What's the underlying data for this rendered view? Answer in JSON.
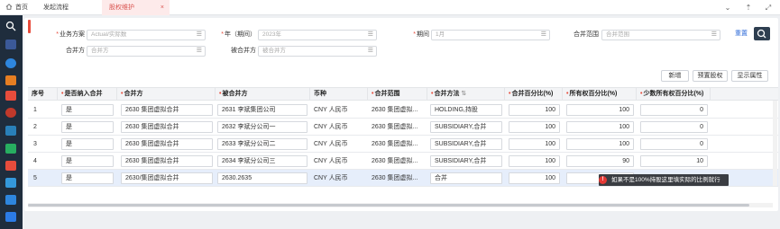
{
  "tabs": {
    "home": "首页",
    "flow": "发起流程",
    "active": "股权维护",
    "close": "×"
  },
  "window_controls": [
    "⌄",
    "⇡",
    "⤢"
  ],
  "filters": {
    "business_plan": {
      "label": "业务方案",
      "placeholder": "Actual/实际数"
    },
    "year": {
      "label": "年（期间）",
      "placeholder": "2023年"
    },
    "period": {
      "label": "期间",
      "placeholder": "1月"
    },
    "consol_scope": {
      "label": "合并范围",
      "placeholder": "合并范围"
    },
    "consol_party": {
      "label": "合并方",
      "placeholder": "合并方"
    },
    "consolidated_party": {
      "label": "被合并方",
      "placeholder": "被合并方"
    },
    "reset": "重置",
    "required_mark": "*"
  },
  "actions": {
    "add": "新增",
    "preset_equity": "预置股权",
    "display_props": "显示属性"
  },
  "table": {
    "columns": {
      "seq": "序号",
      "include": "是否纳入合并",
      "consol_party": "合并方",
      "consolidated_party": "被合并方",
      "currency": "币种",
      "scope": "合并范围",
      "method": "合并方法",
      "consol_pct": "合并百分比(%)",
      "ownership_pct": "所有权百分比(%)",
      "minority_pct": "少数所有权百分比(%)"
    },
    "sort_mark": "⇅",
    "rows": [
      {
        "seq": "1",
        "include": "是",
        "consol_party": "2630 集团虚拟合并",
        "consolidated_party": "2631 李斌集团公司",
        "currency": "CNY 人民币",
        "scope": "2630 集团虚拟...",
        "method": "HOLDING,持股",
        "consol_pct": "100",
        "ownership_pct": "100",
        "minority_pct": "0"
      },
      {
        "seq": "2",
        "include": "是",
        "consol_party": "2630 集团虚拟合并",
        "consolidated_party": "2632 李斌分公司一",
        "currency": "CNY 人民币",
        "scope": "2630 集团虚拟...",
        "method": "SUBSIDIARY,合并",
        "consol_pct": "100",
        "ownership_pct": "100",
        "minority_pct": "0"
      },
      {
        "seq": "3",
        "include": "是",
        "consol_party": "2630 集团虚拟合并",
        "consolidated_party": "2633 李斌分公司二",
        "currency": "CNY 人民币",
        "scope": "2630 集团虚拟...",
        "method": "SUBSIDIARY,合并",
        "consol_pct": "100",
        "ownership_pct": "100",
        "minority_pct": "0"
      },
      {
        "seq": "4",
        "include": "是",
        "consol_party": "2630 集团虚拟合并",
        "consolidated_party": "2634 李斌分公司三",
        "currency": "CNY 人民币",
        "scope": "2630 集团虚拟...",
        "method": "SUBSIDIARY,合并",
        "consol_pct": "100",
        "ownership_pct": "90",
        "minority_pct": "10"
      },
      {
        "seq": "5",
        "include": "是",
        "consol_party": "2630/集团虚拟合并",
        "consolidated_party": "2630.2635",
        "currency": "CNY 人民币",
        "scope": "2630 集团虚拟...",
        "method": "合并",
        "consol_pct": "100",
        "ownership_pct": "",
        "minority_pct": ""
      }
    ]
  },
  "tooltip": {
    "icon": "!",
    "text": "如果不是100%持股这里填实际的比例就行"
  },
  "colors": {
    "sidebar": "#1f2d3d",
    "accent_red": "#e74c3c",
    "link_blue": "#2f6bd8",
    "selected_row": "#e6eefb"
  }
}
